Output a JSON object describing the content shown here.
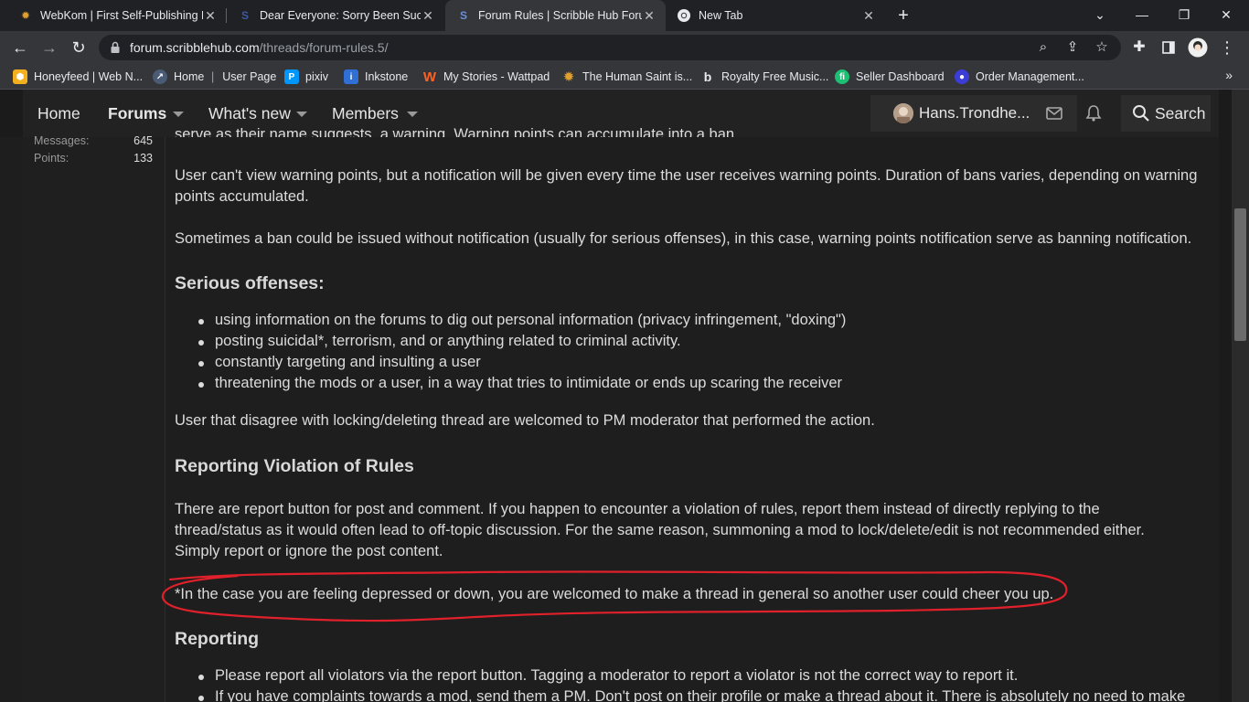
{
  "browser": {
    "tabs": [
      {
        "title": "WebKom | First Self-Publishing Pl",
        "active": false
      },
      {
        "title": "Dear Everyone: Sorry Been Such A",
        "active": false
      },
      {
        "title": "Forum Rules | Scribble Hub Forum",
        "active": true
      },
      {
        "title": "New Tab",
        "active": false
      }
    ],
    "new_tab": "+",
    "url_host": "forum.scribblehub.com",
    "url_path": "/threads/forum-rules.5/",
    "bookmarks": [
      {
        "label": "Honeyfeed | Web N...",
        "icon": "honeyfeed-icon",
        "color": "#f2b01e"
      },
      {
        "label": "Home",
        "icon": "home-icon",
        "color": "#4b5b75"
      },
      {
        "label": "User Page",
        "icon": "user-page-icon",
        "color": "#35363a"
      },
      {
        "label": "pixiv",
        "icon": "pixiv-icon",
        "color": "#0096fa"
      },
      {
        "label": "Inkstone",
        "icon": "inkstone-icon",
        "color": "#2f6fd6"
      },
      {
        "label": "My Stories - Wattpad",
        "icon": "wattpad-icon",
        "color": "#ff6122"
      },
      {
        "label": "The Human Saint is...",
        "icon": "webkom-icon",
        "color": "#e0a030"
      },
      {
        "label": "Royalty Free Music...",
        "icon": "bensound-icon",
        "color": "#111111"
      },
      {
        "label": "Seller Dashboard",
        "icon": "fiverr-icon",
        "color": "#1dbf73"
      },
      {
        "label": "Order Management...",
        "icon": "order-icon",
        "color": "#3c3cd6"
      }
    ],
    "bookmarks_more": "»"
  },
  "site_nav": {
    "items": [
      {
        "label": "Home",
        "selected": false,
        "caret": false
      },
      {
        "label": "Forums",
        "selected": true,
        "caret": true
      },
      {
        "label": "What's new",
        "selected": false,
        "caret": true
      },
      {
        "label": "Members",
        "selected": false,
        "caret": true
      }
    ],
    "username": "Hans.Trondhe...",
    "search_label": "Search"
  },
  "user_stats": [
    {
      "label": "Messages:",
      "value": "645"
    },
    {
      "label": "Points:",
      "value": "133"
    }
  ],
  "post": {
    "partial_top": "serve as their name suggests, a warning. Warning points can accumulate into a ban.",
    "p_warning_points": "User can't view warning points, but a notification will be given every time the user receives warning points. Duration of bans varies, depending on warning points accumulated.",
    "p_ban_notice": "Sometimes a ban could be issued without notification (usually for serious offenses), in this case, warning points notification serve as banning notification.",
    "h_serious": "Serious offenses:",
    "serious_list": [
      "using information on the forums to dig out personal information (privacy infringement, \"doxing\")",
      "posting suicidal*, terrorism, and or anything related to criminal activity.",
      "constantly targeting and insulting a user",
      "threatening the mods or a user, in a way that tries to intimidate or ends up scaring the receiver"
    ],
    "p_disagree": "User that disagree with locking/deleting thread are welcomed to PM moderator that performed the action.",
    "h_reporting_violation": "Reporting Violation of Rules",
    "p_report_button": "There are report button for post and comment. If you happen to encounter a violation of rules, report them instead of directly replying to the thread/status as it would often lead to off-topic discussion. For the same reason, summoning a mod to lock/delete/edit is not recommended either. Simply report or ignore the post content.",
    "p_depressed": "*In the case you are feeling depressed or down, you are welcomed to make a thread in general so another user could cheer you up.",
    "h_reporting": "Reporting",
    "reporting_list": [
      "Please report all violators via the report button. Tagging a moderator to report a violator is not the correct way to report it.",
      "If you have complaints towards a mod, send them a PM. Don't post on their profile or make a thread about it. There is absolutely no need to make"
    ]
  },
  "colors": {
    "annotation": "#e0202a",
    "background": "#1e1e1e"
  }
}
